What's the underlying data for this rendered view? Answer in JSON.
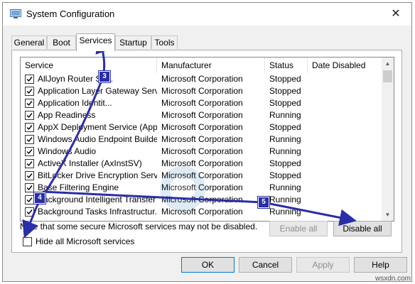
{
  "window": {
    "title": "System Configuration",
    "close_glyph": "✕"
  },
  "tabs": [
    {
      "label": "General",
      "active": false
    },
    {
      "label": "Boot",
      "active": false
    },
    {
      "label": "Services",
      "active": true
    },
    {
      "label": "Startup",
      "active": false
    },
    {
      "label": "Tools",
      "active": false
    }
  ],
  "table": {
    "headers": [
      "Service",
      "Manufacturer",
      "Status",
      "Date Disabled"
    ],
    "rows": [
      {
        "service": "AllJoyn Router Se...",
        "manufacturer": "Microsoft Corporation",
        "status": "Stopped",
        "checked": true
      },
      {
        "service": "Application Layer Gateway Service",
        "manufacturer": "Microsoft Corporation",
        "status": "Stopped",
        "checked": true
      },
      {
        "service": "Application Identit...",
        "manufacturer": "Microsoft Corporation",
        "status": "Stopped",
        "checked": true
      },
      {
        "service": "App Readiness",
        "manufacturer": "Microsoft Corporation",
        "status": "Running",
        "checked": true
      },
      {
        "service": "AppX Deployment Service (AppX...",
        "manufacturer": "Microsoft Corporation",
        "status": "Stopped",
        "checked": true
      },
      {
        "service": "Windows Audio Endpoint Builder",
        "manufacturer": "Microsoft Corporation",
        "status": "Running",
        "checked": true
      },
      {
        "service": "Windows Audio",
        "manufacturer": "Microsoft Corporation",
        "status": "Running",
        "checked": true
      },
      {
        "service": "ActiveX Installer (AxInstSV)",
        "manufacturer": "Microsoft Corporation",
        "status": "Stopped",
        "checked": true
      },
      {
        "service": "BitLocker Drive Encryption Service",
        "manufacturer": "Microsoft Corporation",
        "status": "Stopped",
        "checked": true
      },
      {
        "service": "Base Filtering Engine",
        "manufacturer": "Microsoft Corporation",
        "status": "Running",
        "checked": true
      },
      {
        "service": "Background Intelligent Transfer ...",
        "manufacturer": "Microsoft Corporation",
        "status": "Running",
        "checked": true
      },
      {
        "service": "Background Tasks Infrastructur...",
        "manufacturer": "Microsoft Corporation",
        "status": "Running",
        "checked": true
      }
    ]
  },
  "note": "Note that some secure Microsoft services may not be disabled.",
  "buttons": {
    "enable_all": "Enable all",
    "disable_all": "Disable all",
    "ok": "OK",
    "cancel": "Cancel",
    "apply": "Apply",
    "help": "Help"
  },
  "hide_ms": {
    "label": "Hide all Microsoft services",
    "checked": false
  },
  "annotations": {
    "step3": "3",
    "step4": "4",
    "step5": "5",
    "arrow_color": "#2a2ea8"
  },
  "watermark": {
    "line1": "The Expert Tech Assistance",
    "line2": "Appuals"
  },
  "footer_mark": "wsxdn.com"
}
